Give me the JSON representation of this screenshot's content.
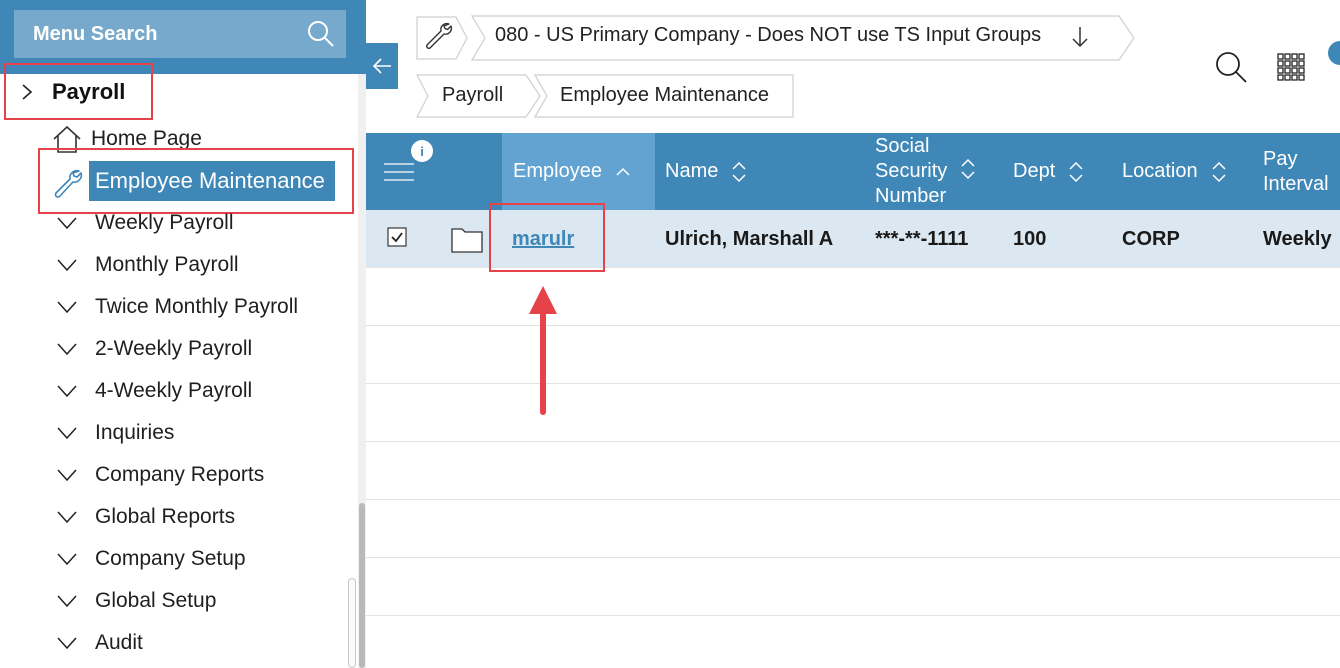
{
  "sidebar": {
    "search_label": "Menu Search",
    "payroll_label": "Payroll",
    "home_label": "Home Page",
    "active_label": "Employee Maintenance",
    "items": [
      {
        "label": "Weekly Payroll"
      },
      {
        "label": "Monthly Payroll"
      },
      {
        "label": "Twice Monthly Payroll"
      },
      {
        "label": "2-Weekly Payroll"
      },
      {
        "label": "4-Weekly Payroll"
      },
      {
        "label": "Inquiries"
      },
      {
        "label": "Company Reports"
      },
      {
        "label": "Global Reports"
      },
      {
        "label": "Company Setup"
      },
      {
        "label": "Global Setup"
      },
      {
        "label": "Audit"
      }
    ]
  },
  "breadcrumb": {
    "company": "080 - US Primary Company - Does NOT use TS Input Groups",
    "module": "Payroll",
    "page": "Employee Maintenance"
  },
  "table": {
    "info_badge": "i",
    "columns": {
      "employee": "Employee",
      "name": "Name",
      "ssn_line1": "Social",
      "ssn_line2": "Security",
      "ssn_line3": "Number",
      "dept": "Dept",
      "location": "Location",
      "interval_line1": "Pay",
      "interval_line2": "Interval"
    },
    "rows": [
      {
        "employee": "marulr",
        "name": "Ulrich, Marshall A",
        "ssn": "***-**-1111",
        "dept": "100",
        "location": "CORP",
        "interval": "Weekly"
      }
    ]
  },
  "colors": {
    "primary": "#3f87b6",
    "highlight": "#62a3d1",
    "annotation": "#e5424a",
    "selected_row": "#dbe8f1"
  },
  "icons": [
    "search-icon",
    "chevron-right-icon",
    "home-icon",
    "wrench-icon",
    "chevron-down-icon",
    "arrow-left-icon",
    "arrow-down-icon",
    "apps-grid-icon",
    "menu-lines-icon",
    "info-icon",
    "sort-icon",
    "checkbox-icon",
    "folder-icon"
  ]
}
